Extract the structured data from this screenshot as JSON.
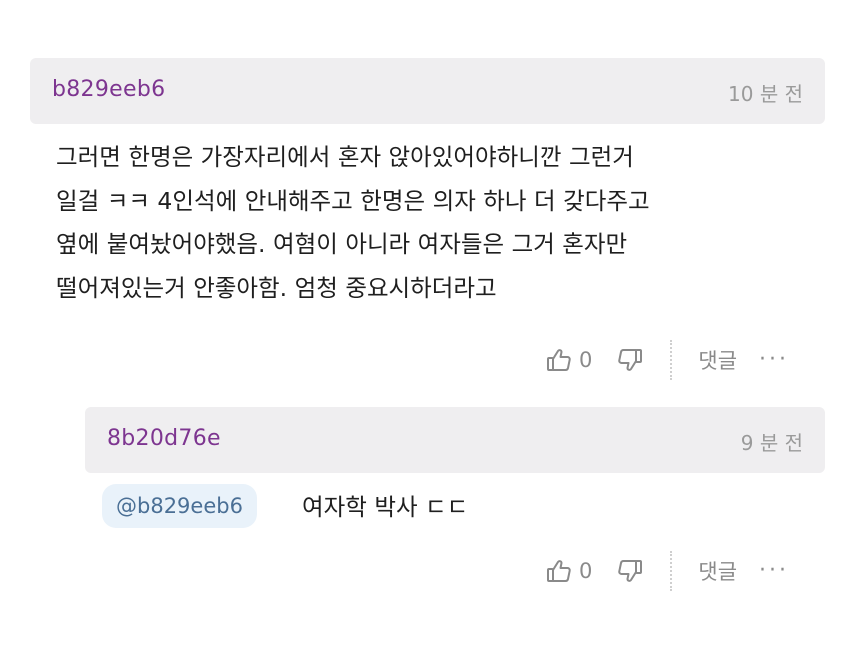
{
  "comments": [
    {
      "author": "b829eeb6",
      "time": "10 분 전",
      "text": "그러면 한명은 가장자리에서 혼자 앉아있어야하니깐 그런거\n일걸 ㅋㅋ 4인석에 안내해주고 한명은 의자 하나 더 갖다주고\n옆에 붙여놨어야했음. 여혐이 아니라 여자들은 그거 혼자만\n떨어져있는거 안좋아함. 엄청 중요시하더라고",
      "likes": "0",
      "reply_label": "댓글",
      "more": "···"
    },
    {
      "author": "8b20d76e",
      "time": "9 분 전",
      "mention": "@b829eeb6",
      "text": "여자학 박사 ㄷㄷ",
      "likes": "0",
      "reply_label": "댓글",
      "more": "···"
    }
  ],
  "icons": {
    "like": "thumbs-up-icon",
    "dislike": "thumbs-down-icon",
    "more": "more-icon"
  },
  "colors": {
    "author": "#7d3590",
    "header_bg": "#efeef0",
    "mention_bg": "#e9f2fa",
    "mention_text": "#4a6f95",
    "meta_gray": "#9a9a9a"
  }
}
